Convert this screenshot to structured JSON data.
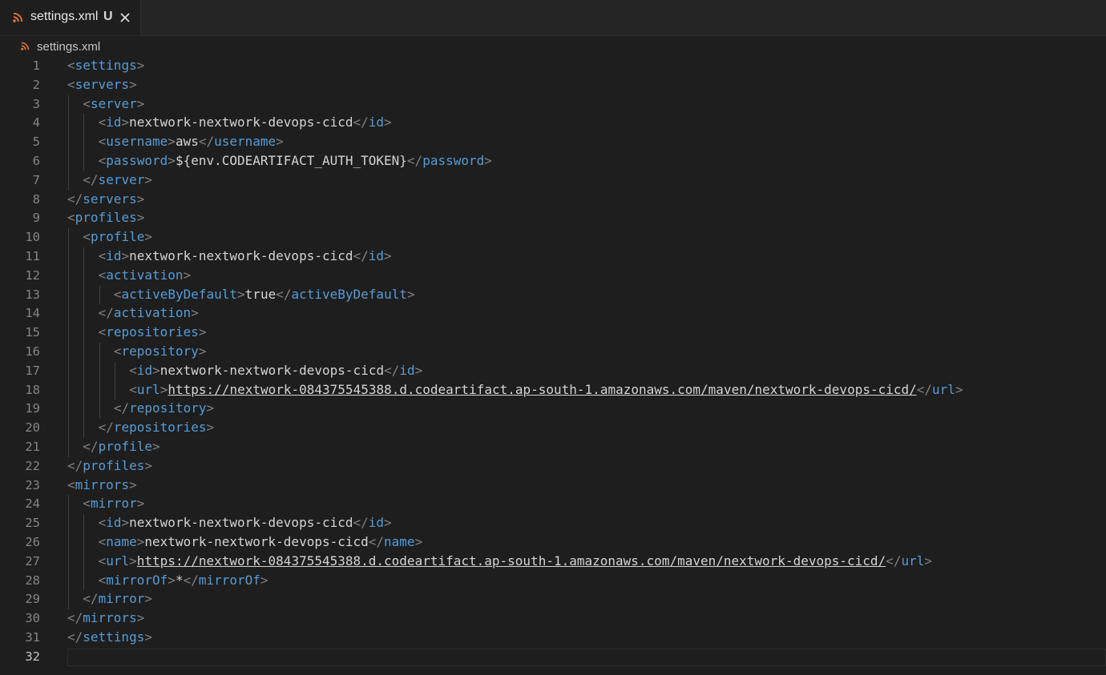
{
  "tab": {
    "label": "settings.xml",
    "status": "U",
    "icon": "rss-icon"
  },
  "breadcrumb": {
    "label": "settings.xml",
    "icon": "rss-icon"
  },
  "colors": {
    "tag": "#569cd6",
    "bracket": "#808080",
    "text": "#d4d4d4",
    "icon": "#e37933"
  },
  "editor": {
    "cursor_line": 32,
    "lines": [
      {
        "n": "1",
        "indent": 0,
        "parts": [
          [
            "punct",
            "<"
          ],
          [
            "tag",
            "settings"
          ],
          [
            "punct",
            ">"
          ]
        ]
      },
      {
        "n": "2",
        "indent": 0,
        "parts": [
          [
            "punct",
            "<"
          ],
          [
            "tag",
            "servers"
          ],
          [
            "punct",
            ">"
          ]
        ]
      },
      {
        "n": "3",
        "indent": 1,
        "parts": [
          [
            "punct",
            "<"
          ],
          [
            "tag",
            "server"
          ],
          [
            "punct",
            ">"
          ]
        ]
      },
      {
        "n": "4",
        "indent": 2,
        "parts": [
          [
            "punct",
            "<"
          ],
          [
            "tag",
            "id"
          ],
          [
            "punct",
            ">"
          ],
          [
            "txt",
            "nextwork-nextwork-devops-cicd"
          ],
          [
            "punct",
            "</"
          ],
          [
            "tag",
            "id"
          ],
          [
            "punct",
            ">"
          ]
        ]
      },
      {
        "n": "5",
        "indent": 2,
        "parts": [
          [
            "punct",
            "<"
          ],
          [
            "tag",
            "username"
          ],
          [
            "punct",
            ">"
          ],
          [
            "txt",
            "aws"
          ],
          [
            "punct",
            "</"
          ],
          [
            "tag",
            "username"
          ],
          [
            "punct",
            ">"
          ]
        ]
      },
      {
        "n": "6",
        "indent": 2,
        "parts": [
          [
            "punct",
            "<"
          ],
          [
            "tag",
            "password"
          ],
          [
            "punct",
            ">"
          ],
          [
            "txt",
            "${env.CODEARTIFACT_AUTH_TOKEN}"
          ],
          [
            "punct",
            "</"
          ],
          [
            "tag",
            "password"
          ],
          [
            "punct",
            ">"
          ]
        ]
      },
      {
        "n": "7",
        "indent": 1,
        "parts": [
          [
            "punct",
            "</"
          ],
          [
            "tag",
            "server"
          ],
          [
            "punct",
            ">"
          ]
        ]
      },
      {
        "n": "8",
        "indent": 0,
        "parts": [
          [
            "punct",
            "</"
          ],
          [
            "tag",
            "servers"
          ],
          [
            "punct",
            ">"
          ]
        ]
      },
      {
        "n": "9",
        "indent": 0,
        "parts": [
          [
            "punct",
            "<"
          ],
          [
            "tag",
            "profiles"
          ],
          [
            "punct",
            ">"
          ]
        ]
      },
      {
        "n": "10",
        "indent": 1,
        "parts": [
          [
            "punct",
            "<"
          ],
          [
            "tag",
            "profile"
          ],
          [
            "punct",
            ">"
          ]
        ]
      },
      {
        "n": "11",
        "indent": 2,
        "parts": [
          [
            "punct",
            "<"
          ],
          [
            "tag",
            "id"
          ],
          [
            "punct",
            ">"
          ],
          [
            "txt",
            "nextwork-nextwork-devops-cicd"
          ],
          [
            "punct",
            "</"
          ],
          [
            "tag",
            "id"
          ],
          [
            "punct",
            ">"
          ]
        ]
      },
      {
        "n": "12",
        "indent": 2,
        "parts": [
          [
            "punct",
            "<"
          ],
          [
            "tag",
            "activation"
          ],
          [
            "punct",
            ">"
          ]
        ]
      },
      {
        "n": "13",
        "indent": 3,
        "parts": [
          [
            "punct",
            "<"
          ],
          [
            "tag",
            "activeByDefault"
          ],
          [
            "punct",
            ">"
          ],
          [
            "txt",
            "true"
          ],
          [
            "punct",
            "</"
          ],
          [
            "tag",
            "activeByDefault"
          ],
          [
            "punct",
            ">"
          ]
        ]
      },
      {
        "n": "14",
        "indent": 2,
        "parts": [
          [
            "punct",
            "</"
          ],
          [
            "tag",
            "activation"
          ],
          [
            "punct",
            ">"
          ]
        ]
      },
      {
        "n": "15",
        "indent": 2,
        "parts": [
          [
            "punct",
            "<"
          ],
          [
            "tag",
            "repositories"
          ],
          [
            "punct",
            ">"
          ]
        ]
      },
      {
        "n": "16",
        "indent": 3,
        "parts": [
          [
            "punct",
            "<"
          ],
          [
            "tag",
            "repository"
          ],
          [
            "punct",
            ">"
          ]
        ]
      },
      {
        "n": "17",
        "indent": 4,
        "parts": [
          [
            "punct",
            "<"
          ],
          [
            "tag",
            "id"
          ],
          [
            "punct",
            ">"
          ],
          [
            "txt",
            "nextwork-nextwork-devops-cicd"
          ],
          [
            "punct",
            "</"
          ],
          [
            "tag",
            "id"
          ],
          [
            "punct",
            ">"
          ]
        ]
      },
      {
        "n": "18",
        "indent": 4,
        "parts": [
          [
            "punct",
            "<"
          ],
          [
            "tag",
            "url"
          ],
          [
            "punct",
            ">"
          ],
          [
            "link",
            "https://nextwork-084375545388.d.codeartifact.ap-south-1.amazonaws.com/maven/nextwork-devops-cicd/"
          ],
          [
            "punct",
            "</"
          ],
          [
            "tag",
            "url"
          ],
          [
            "punct",
            ">"
          ]
        ]
      },
      {
        "n": "19",
        "indent": 3,
        "parts": [
          [
            "punct",
            "</"
          ],
          [
            "tag",
            "repository"
          ],
          [
            "punct",
            ">"
          ]
        ]
      },
      {
        "n": "20",
        "indent": 2,
        "parts": [
          [
            "punct",
            "</"
          ],
          [
            "tag",
            "repositories"
          ],
          [
            "punct",
            ">"
          ]
        ]
      },
      {
        "n": "21",
        "indent": 1,
        "parts": [
          [
            "punct",
            "</"
          ],
          [
            "tag",
            "profile"
          ],
          [
            "punct",
            ">"
          ]
        ]
      },
      {
        "n": "22",
        "indent": 0,
        "parts": [
          [
            "punct",
            "</"
          ],
          [
            "tag",
            "profiles"
          ],
          [
            "punct",
            ">"
          ]
        ]
      },
      {
        "n": "23",
        "indent": 0,
        "parts": [
          [
            "punct",
            "<"
          ],
          [
            "tag",
            "mirrors"
          ],
          [
            "punct",
            ">"
          ]
        ]
      },
      {
        "n": "24",
        "indent": 1,
        "parts": [
          [
            "punct",
            "<"
          ],
          [
            "tag",
            "mirror"
          ],
          [
            "punct",
            ">"
          ]
        ]
      },
      {
        "n": "25",
        "indent": 2,
        "parts": [
          [
            "punct",
            "<"
          ],
          [
            "tag",
            "id"
          ],
          [
            "punct",
            ">"
          ],
          [
            "txt",
            "nextwork-nextwork-devops-cicd"
          ],
          [
            "punct",
            "</"
          ],
          [
            "tag",
            "id"
          ],
          [
            "punct",
            ">"
          ]
        ]
      },
      {
        "n": "26",
        "indent": 2,
        "parts": [
          [
            "punct",
            "<"
          ],
          [
            "tag",
            "name"
          ],
          [
            "punct",
            ">"
          ],
          [
            "txt",
            "nextwork-nextwork-devops-cicd"
          ],
          [
            "punct",
            "</"
          ],
          [
            "tag",
            "name"
          ],
          [
            "punct",
            ">"
          ]
        ]
      },
      {
        "n": "27",
        "indent": 2,
        "parts": [
          [
            "punct",
            "<"
          ],
          [
            "tag",
            "url"
          ],
          [
            "punct",
            ">"
          ],
          [
            "link",
            "https://nextwork-084375545388.d.codeartifact.ap-south-1.amazonaws.com/maven/nextwork-devops-cicd/"
          ],
          [
            "punct",
            "</"
          ],
          [
            "tag",
            "url"
          ],
          [
            "punct",
            ">"
          ]
        ]
      },
      {
        "n": "28",
        "indent": 2,
        "parts": [
          [
            "punct",
            "<"
          ],
          [
            "tag",
            "mirrorOf"
          ],
          [
            "punct",
            ">"
          ],
          [
            "txt",
            "*"
          ],
          [
            "punct",
            "</"
          ],
          [
            "tag",
            "mirrorOf"
          ],
          [
            "punct",
            ">"
          ]
        ]
      },
      {
        "n": "29",
        "indent": 1,
        "parts": [
          [
            "punct",
            "</"
          ],
          [
            "tag",
            "mirror"
          ],
          [
            "punct",
            ">"
          ]
        ]
      },
      {
        "n": "30",
        "indent": 0,
        "parts": [
          [
            "punct",
            "</"
          ],
          [
            "tag",
            "mirrors"
          ],
          [
            "punct",
            ">"
          ]
        ]
      },
      {
        "n": "31",
        "indent": 0,
        "parts": [
          [
            "punct",
            "</"
          ],
          [
            "tag",
            "settings"
          ],
          [
            "punct",
            ">"
          ]
        ]
      },
      {
        "n": "32",
        "indent": 0,
        "parts": []
      }
    ]
  }
}
